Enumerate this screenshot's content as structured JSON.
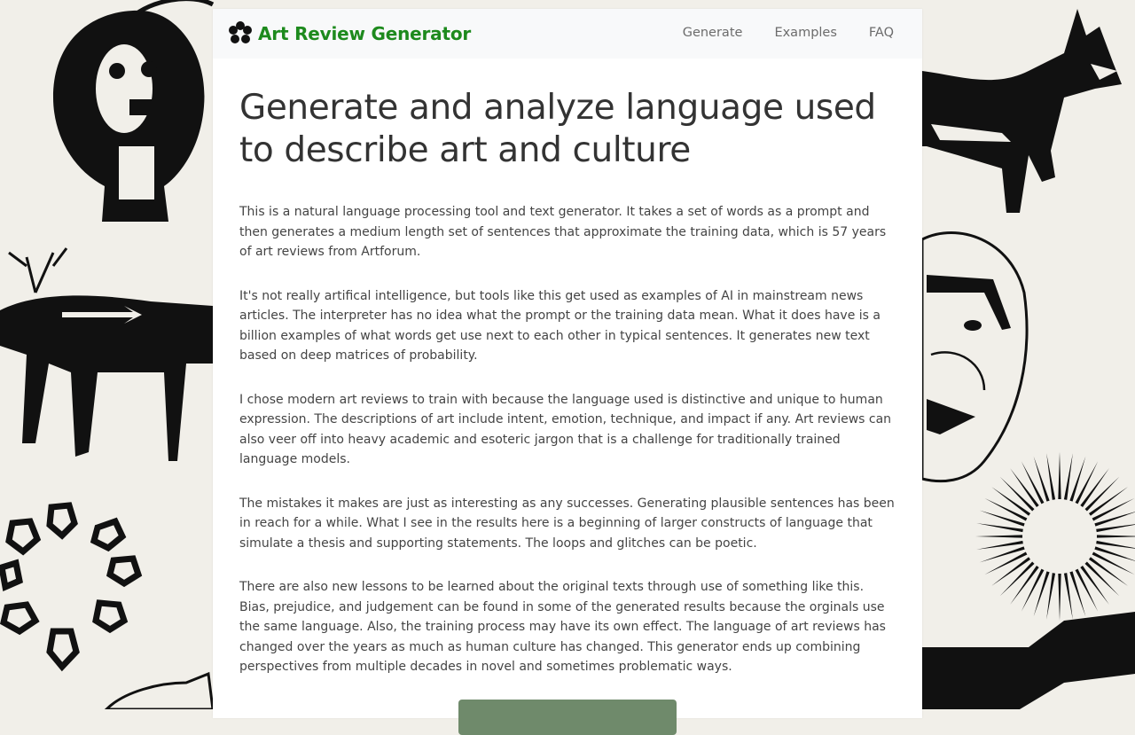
{
  "brand": {
    "name": "Art Review Generator"
  },
  "nav": {
    "items": [
      {
        "label": "Generate"
      },
      {
        "label": "Examples"
      },
      {
        "label": "FAQ"
      }
    ]
  },
  "main": {
    "heading": "Generate and analyze language used to describe art and culture",
    "paragraphs": [
      "This is a natural language processing tool and text generator. It takes a set of words as a prompt and then generates a medium length set of sentences that approximate the training data, which is 57 years of art reviews from Artforum.",
      "It's not really artifical intelligence, but tools like this get used as examples of AI in mainstream news articles. The interpreter has no idea what the prompt or the training data mean. What it does have is a billion examples of what words get use next to each other in typical sentences. It generates new text based on deep matrices of probability.",
      "I chose modern art reviews to train with because the language used is distinctive and unique to human expression. The descriptions of art include intent, emotion, technique, and impact if any. Art reviews can also veer off into heavy academic and esoteric jargon that is a challenge for traditionally trained language models.",
      "The mistakes it makes are just as interesting as any successes. Generating plausible sentences has been in reach for a while. What I see in the results here is a beginning of larger constructs of language that simulate a thesis and supporting statements. The loops and glitches can be poetic.",
      "There are also new lessons to be learned about the original texts through use of something like this. Bias, prejudice, and judgement can be found in some of the generated results because the orginals use the same language. Also, the training process may have its own effect. The language of art reviews has changed over the years as much as human culture has changed. This generator ends up combining perspectives from multiple decades in novel and sometimes problematic ways."
    ]
  },
  "cta": {
    "label": ""
  },
  "colors": {
    "brand": "#1d8a1d",
    "page_background": "#f1efe9",
    "navbar_background": "#f8f9fa",
    "button": "#6f8a6b"
  },
  "background_icons": [
    "skull-face-drawing-icon",
    "wolf-drawing-icon",
    "deer-drawing-icon",
    "mask-face-drawing-icon",
    "ring-of-shapes-icon",
    "sunburst-icon"
  ]
}
